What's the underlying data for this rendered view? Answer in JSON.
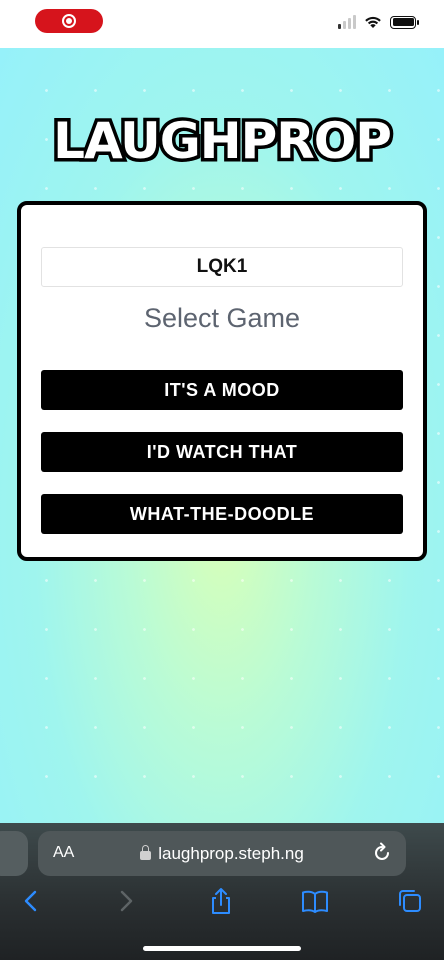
{
  "status_bar": {
    "recording_indicator": "screen-recording",
    "icons": [
      "signal-icon",
      "wifi-icon",
      "battery-icon"
    ]
  },
  "app": {
    "logo_text": "LAUGHPROP"
  },
  "card": {
    "room_code": "LQK1",
    "heading": "Select Game",
    "games": [
      {
        "label": "IT'S A MOOD"
      },
      {
        "label": "I'D WATCH THAT"
      },
      {
        "label": "WHAT-THE-DOODLE"
      }
    ]
  },
  "browser": {
    "text_size_label": "AA",
    "url": "laughprop.steph.ng",
    "toolbar": [
      "back-icon",
      "forward-icon",
      "share-icon",
      "bookmarks-icon",
      "tabs-icon"
    ]
  },
  "colors": {
    "background_start": "#96f1fa",
    "background_center": "#d8ffb8",
    "button": "#000000",
    "recording": "#d6141c",
    "ios_blue": "#2d8cff"
  }
}
